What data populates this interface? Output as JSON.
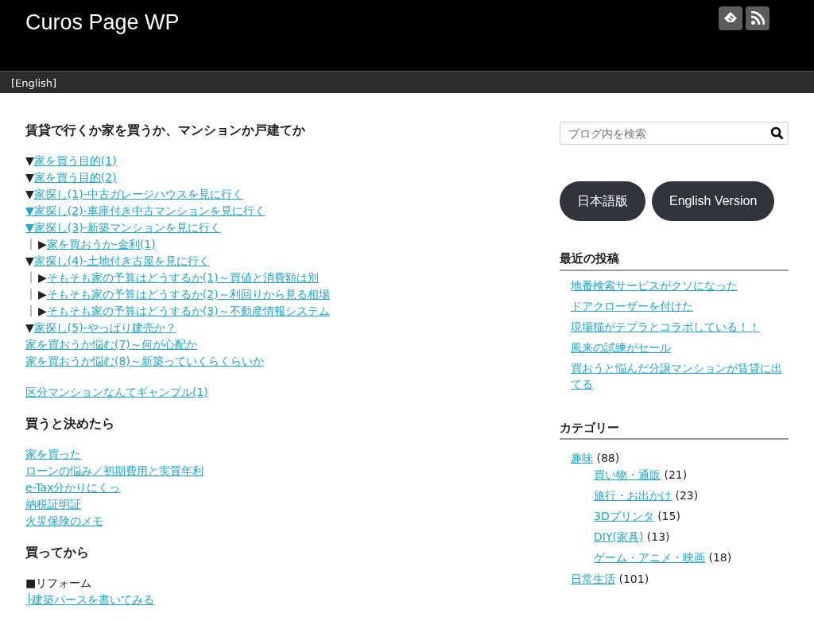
{
  "site": {
    "title": "Curos Page WP"
  },
  "nav": {
    "items": [
      "[English]"
    ]
  },
  "sections": [
    {
      "heading": "賃貸で行くか家を買うか、マンションか戸建てか",
      "groups": [
        [
          {
            "kind": "top",
            "marker": "▼",
            "link": "家を買う目的(1)"
          },
          {
            "kind": "top",
            "marker": "▼",
            "link": "家を買う目的(2)"
          },
          {
            "kind": "top",
            "marker": "▼",
            "link": "家探し(1)-中古ガレージハウスを見に行く"
          },
          {
            "kind": "linked",
            "marker": "▼",
            "link": "家探し(2)-車庫付き中古マンションを見に行く"
          },
          {
            "kind": "linked",
            "marker": "▼",
            "link": "家探し(3)-新築マンションを見に行く"
          },
          {
            "kind": "sub",
            "marker": "▶",
            "link": "家を買おうか-金利(1)"
          },
          {
            "kind": "top",
            "marker": "▼",
            "link": "家探し(4)-土地付き古屋を見に行く"
          },
          {
            "kind": "sub",
            "marker": "▶",
            "link": "そもそも家の予算はどうするか(1)～買値と消費額は別"
          },
          {
            "kind": "sub",
            "marker": "▶",
            "link": "そもそも家の予算はどうするか(2)～利回りから見る相場"
          },
          {
            "kind": "sub",
            "marker": "▶",
            "link": "そもそも家の予算はどうするか(3)～不動産情報システム"
          },
          {
            "kind": "top",
            "marker": "▼",
            "link": "家探し(5)-やっぱり建売か？"
          },
          {
            "kind": "plain",
            "link": "家を買おうか悩む(7)～何が心配か"
          },
          {
            "kind": "plain",
            "link": "家を買おうか悩む(8)～新築っていくらくらいか "
          }
        ],
        [
          {
            "kind": "plain",
            "link": "区分マンションなんてギャンブル(1)"
          }
        ]
      ]
    },
    {
      "heading": "買うと決めたら",
      "groups": [
        [
          {
            "kind": "plain",
            "link": "家を買った"
          },
          {
            "kind": "plain",
            "link": "ローンの悩み／初期費用と実質年利"
          },
          {
            "kind": "plain",
            "link": "e-Tax分かりにくっ"
          },
          {
            "kind": "plain",
            "link": "納税証明証"
          },
          {
            "kind": "plain",
            "link": "火災保険のメモ"
          }
        ]
      ]
    },
    {
      "heading": "買ってから",
      "groups": [
        [
          {
            "kind": "label",
            "text": "■リフォーム"
          },
          {
            "kind": "plain",
            "link": "├建築パースを書いてみる"
          }
        ]
      ]
    }
  ],
  "sidebar": {
    "search": {
      "placeholder": "ブログ内を検索"
    },
    "buttons": [
      "日本語版",
      "English Version"
    ],
    "recent": {
      "title": "最近の投稿",
      "items": [
        "地番検索サービスがクソになった",
        "ドアクローザーを付けた",
        "現場猫がテプラとコラボしている！！",
        "風来の試練がセール",
        "買おうと悩んだ分譲マンションが賃貸に出てる"
      ]
    },
    "categories": {
      "title": "カテゴリー",
      "items": [
        {
          "name": "趣味",
          "count": "(88)",
          "children": [
            {
              "name": "買い物・通販",
              "count": "(21)"
            },
            {
              "name": "旅行・お出かけ",
              "count": "(23)"
            },
            {
              "name": "3Dプリンタ",
              "count": "(15)"
            },
            {
              "name": "DIY(家具)",
              "count": "(13)"
            },
            {
              "name": "ゲーム・アニメ・映画",
              "count": "(18)"
            }
          ]
        },
        {
          "name": "日常生活",
          "count": "(101)"
        }
      ]
    }
  }
}
